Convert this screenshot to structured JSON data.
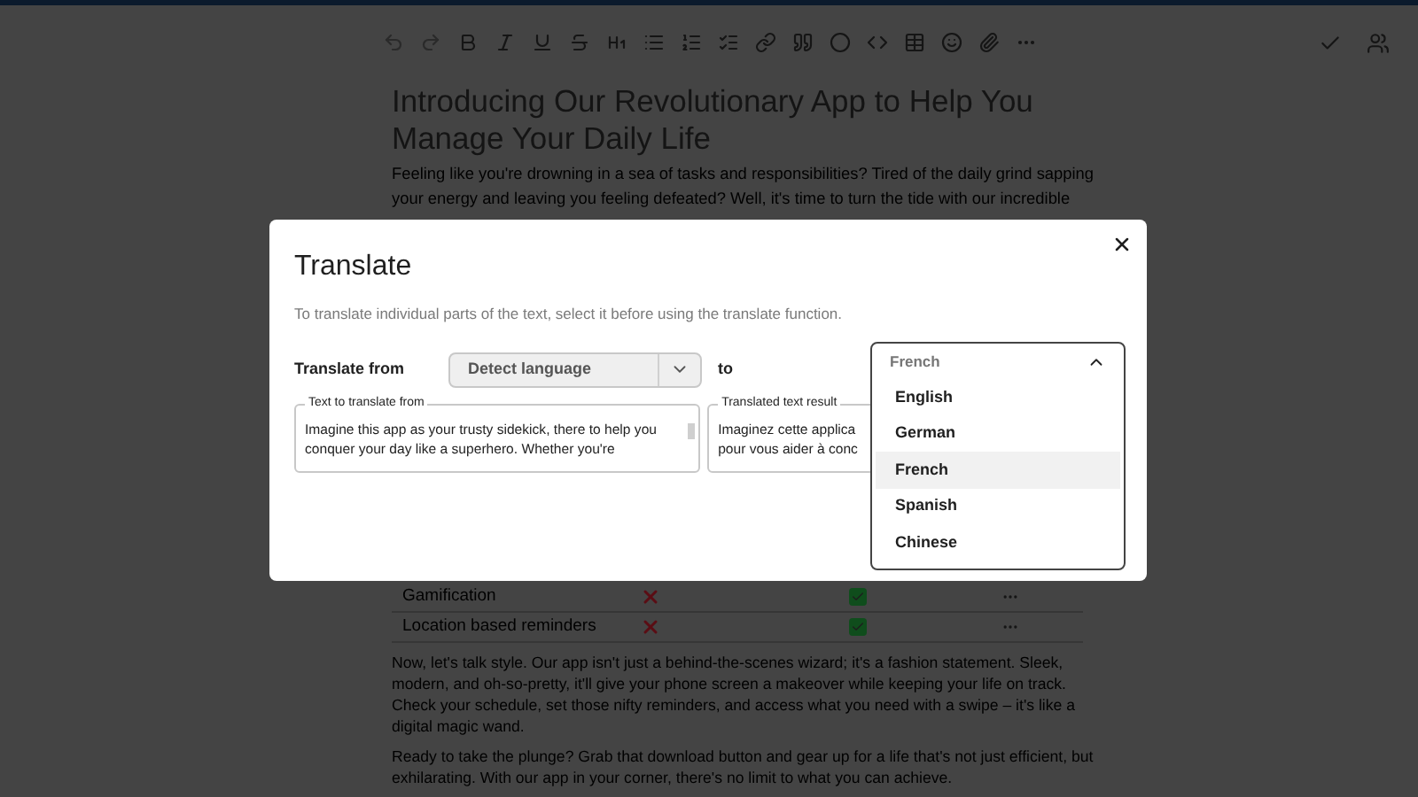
{
  "document": {
    "title": "Introducing Our Revolutionary App to Help You Manage Your Daily Life",
    "intro": "Feeling like you're drowning in a sea of tasks and responsibilities? Tired of the daily grind sapping your energy and leaving you feeling defeated? Well, it's time to turn the tide with our incredible",
    "table_rows": [
      {
        "feature": "Gamification",
        "mark_1": false,
        "mark_2": true
      },
      {
        "feature": "Location based reminders",
        "mark_1": false,
        "mark_2": true
      }
    ],
    "paragraphs": [
      "Now, let's talk style. Our app isn't just a behind-the-scenes wizard; it's a fashion statement. Sleek, modern, and oh-so-pretty, it'll give your phone screen a makeover while keeping your life on track. Check your schedule, set those nifty reminders, and access what you need with a swipe – it's like a digital magic wand.",
      "Ready to take the plunge? Grab that download button and gear up for a life that's not just efficient, but exhilarating. With our app in your corner, there's no limit to what you can achieve."
    ]
  },
  "dialog": {
    "title": "Translate",
    "hint": "To translate individual parts of the text, select it before using the translate function.",
    "from_label": "Translate from",
    "from_select": {
      "value": "Detect language",
      "expanded": false
    },
    "to_label": "to",
    "source": {
      "label": "Text to translate from",
      "lines": [
        "Imagine this app as your trusty sidekick, there to help you",
        "conquer your day like a superhero. Whether you're"
      ]
    },
    "result": {
      "label": "Translated text result",
      "lines": [
        "Imaginez cette applica",
        "pour vous aider à conc"
      ]
    },
    "target": {
      "value": "French",
      "expanded": true,
      "options": [
        {
          "label": "English",
          "selected": false
        },
        {
          "label": "German",
          "selected": false
        },
        {
          "label": "French",
          "selected": true
        },
        {
          "label": "Spanish",
          "selected": false
        },
        {
          "label": "Chinese",
          "selected": false
        }
      ]
    }
  }
}
